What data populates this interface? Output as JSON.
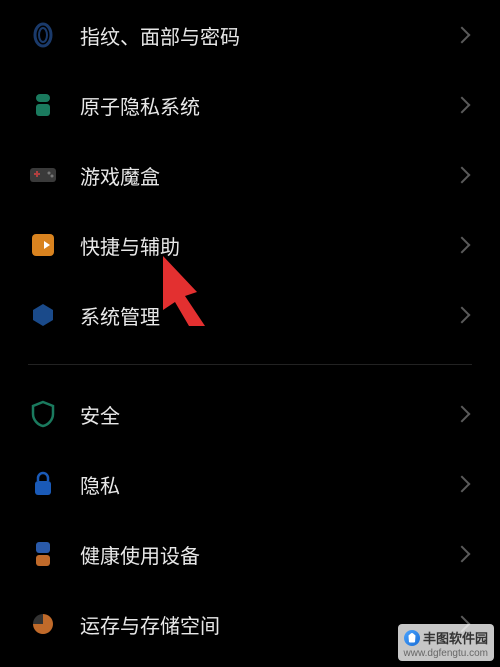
{
  "items_group1": [
    {
      "key": "fingerprint-face-password",
      "label": "指纹、面部与密码"
    },
    {
      "key": "atomic-privacy-system",
      "label": "原子隐私系统"
    },
    {
      "key": "game-box",
      "label": "游戏魔盒"
    },
    {
      "key": "shortcut-accessibility",
      "label": "快捷与辅助"
    },
    {
      "key": "system-management",
      "label": "系统管理"
    }
  ],
  "items_group2": [
    {
      "key": "security",
      "label": "安全"
    },
    {
      "key": "privacy",
      "label": "隐私"
    },
    {
      "key": "digital-wellbeing",
      "label": "健康使用设备"
    },
    {
      "key": "storage",
      "label": "运存与存储空间"
    }
  ],
  "watermark": {
    "name": "丰图软件园",
    "url": "www.dgfengtu.com"
  },
  "pointer_target_index": 3,
  "colors": {
    "pointer": "#e33030",
    "chevron": "#5a5a5a"
  }
}
